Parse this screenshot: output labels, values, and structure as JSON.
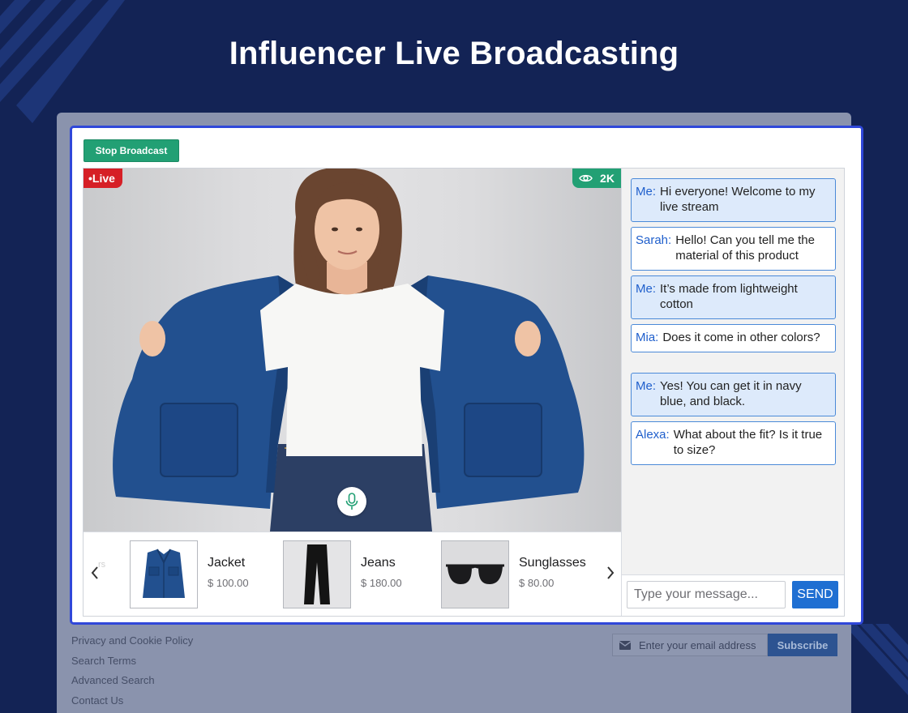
{
  "page": {
    "title": "Influencer Live Broadcasting"
  },
  "broadcast": {
    "stop_label": "Stop Broadcast",
    "live_label": "•Live",
    "viewer_count": "2K",
    "icons": {
      "views": "eye-icon",
      "mic": "microphone-icon"
    }
  },
  "products": {
    "fade_text": "rs",
    "items": [
      {
        "name": "Jacket",
        "price": "$ 100.00",
        "icon": "jacket-image"
      },
      {
        "name": "Jeans",
        "price": "$ 180.00",
        "icon": "jeans-image"
      },
      {
        "name": "Sunglasses",
        "price": "$ 80.00",
        "icon": "sunglasses-image"
      }
    ],
    "icons": {
      "prev": "chevron-left-icon",
      "next": "chevron-right-icon"
    }
  },
  "chat": {
    "messages": [
      {
        "sender": "Me:",
        "text": "Hi everyone! Welcome to my live stream",
        "self": true
      },
      {
        "sender": "Sarah:",
        "text": "Hello! Can you tell me the material of this product",
        "self": false
      },
      {
        "sender": "Me:",
        "text": "It’s made from lightweight cotton",
        "self": true
      },
      {
        "sender": "Mia:",
        "text": "Does it come in other colors?",
        "self": false
      },
      {
        "sender": "Me:",
        "text": "Yes! You can get it in navy blue, and black.",
        "self": true
      },
      {
        "sender": "Alexa:",
        "text": "What about the fit? Is it true to size?",
        "self": false
      }
    ],
    "input_placeholder": "Type your message...",
    "send_label": "SEND"
  },
  "footer": {
    "links": [
      "Privacy and Cookie Policy",
      "Search Terms",
      "Advanced Search",
      "Contact Us"
    ],
    "newsletter_placeholder": "Enter your email address",
    "subscribe_label": "Subscribe"
  },
  "colors": {
    "background": "#132355",
    "accent_green": "#22a074",
    "live_red": "#d61f26",
    "frame_blue": "#2f47d9",
    "send_blue": "#1f6fd2",
    "jacket_blue": "#22508f"
  }
}
